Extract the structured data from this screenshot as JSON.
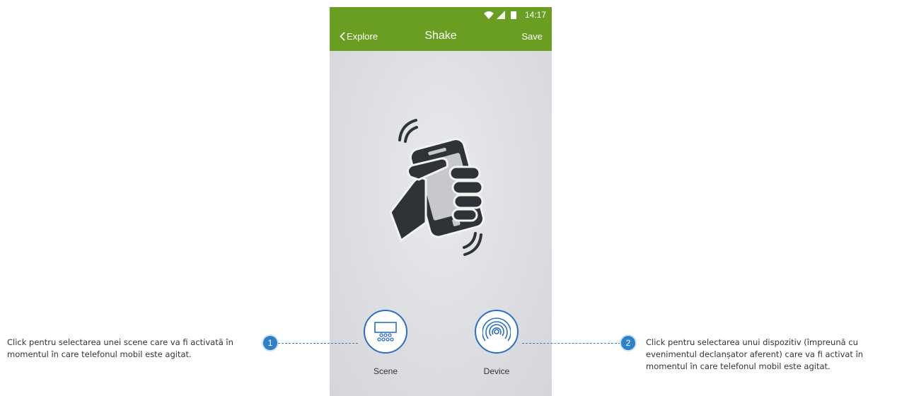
{
  "status_bar": {
    "time": "14:17"
  },
  "nav": {
    "back_label": "Explore",
    "title": "Shake",
    "save_label": "Save"
  },
  "actions": [
    {
      "label": "Scene",
      "icon": "scene-icon"
    },
    {
      "label": "Device",
      "icon": "device-icon"
    }
  ],
  "callouts": [
    {
      "number": "1",
      "text": "Click pentru selectarea unei scene care va fi activată în momentul în care telefonul mobil este agitat."
    },
    {
      "number": "2",
      "text": "Click pentru selectarea unui dispozitiv (împreună cu evenimentul declanșator aferent) care va fi activat în momentul în care telefonul mobil este agitat."
    }
  ],
  "colors": {
    "header": "#6a9e23",
    "accent": "#2b6fc2",
    "callout": "#2f80c5"
  }
}
